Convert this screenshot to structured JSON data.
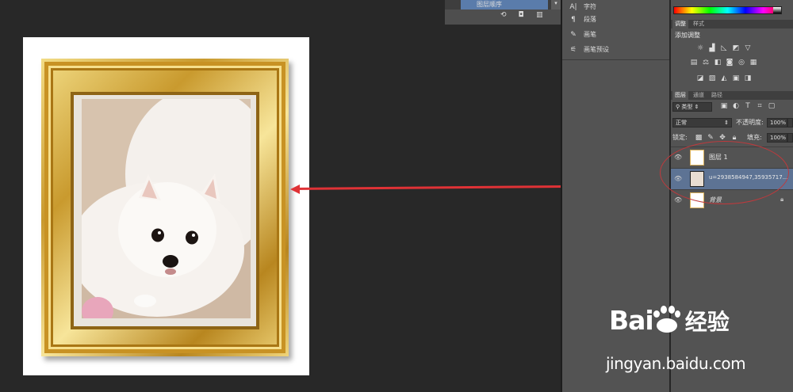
{
  "panel_top": {
    "selected_item": "图层顺序",
    "dropdown_icon": "dropdown-arrow-icon",
    "tools": [
      "fx-icon",
      "camera-icon",
      "trash-icon"
    ]
  },
  "panel_mid": {
    "items": [
      {
        "icon": "character-icon",
        "label": "字符"
      },
      {
        "icon": "paragraph-icon",
        "label": "段落"
      },
      {
        "icon": "brush-icon",
        "label": "画笔"
      },
      {
        "icon": "brush-presets-icon",
        "label": "画笔预设"
      }
    ]
  },
  "adjustments": {
    "tabs": [
      "调整",
      "样式"
    ],
    "title": "添加调整"
  },
  "layers_panel": {
    "tabs": [
      "图层",
      "通道",
      "路径"
    ],
    "filter_label": "类型",
    "blend_mode": "正常",
    "opacity_label": "不透明度:",
    "opacity_value": "100%",
    "lock_label": "锁定:",
    "fill_label": "填充:",
    "fill_value": "100%",
    "layers": [
      {
        "name": "图层 1"
      },
      {
        "name": "u=2938584947,35935717..."
      },
      {
        "name": "背景"
      }
    ]
  },
  "watermark": {
    "brand_left": "Bai",
    "brand_right": "经验",
    "url": "jingyan.baidu.com"
  },
  "colors": {
    "arrow": "#e03236",
    "selection": "#5d7394",
    "ellipse": "#c0393c"
  }
}
